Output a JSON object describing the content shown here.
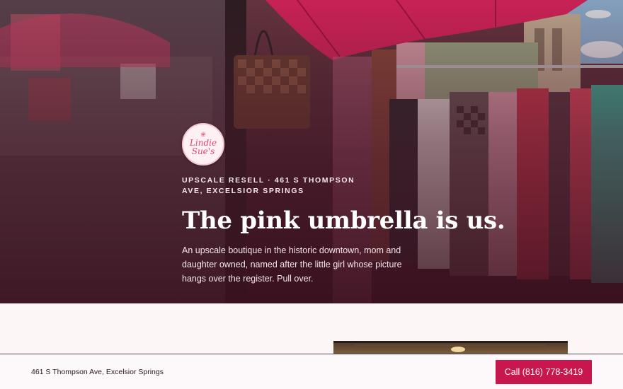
{
  "hero": {
    "logo_line1": "Lindie",
    "logo_line2": "Sue's",
    "eyebrow": "UPSCALE RESELL · 461 S THOMPSON AVE, EXCELSIOR SPRINGS",
    "headline": "The pink umbrella is us.",
    "lede": "An upscale boutique in the historic downtown, mom and daughter owned, named after the little girl whose picture hangs over the register. Pull over."
  },
  "sticky_bar": {
    "address": "461 S Thompson Ave, Excelsior Springs",
    "call_label": "Call (816) 778-3419"
  },
  "colors": {
    "accent": "#c8174f",
    "umbrella": "#e0245e",
    "hero_overlay": "#4a1a2a"
  }
}
